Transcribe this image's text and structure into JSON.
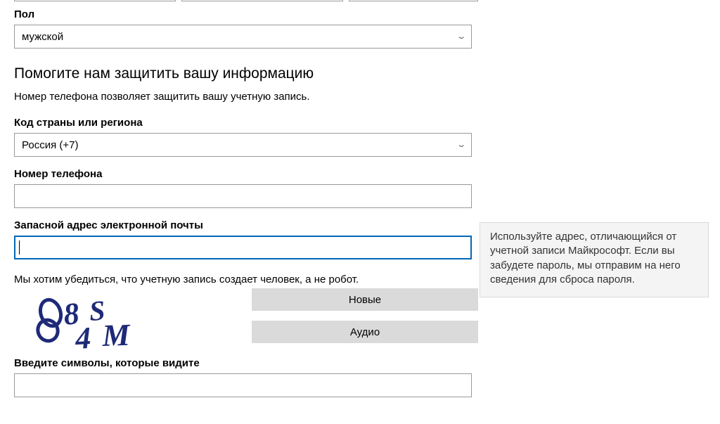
{
  "gender": {
    "label": "Пол",
    "value": "мужской"
  },
  "section_heading": "Помогите нам защитить вашу информацию",
  "section_subtext": "Номер телефона позволяет защитить вашу учетную запись.",
  "country_code": {
    "label": "Код страны или региона",
    "value": "Россия (+7)"
  },
  "phone": {
    "label": "Номер телефона",
    "value": ""
  },
  "backup_email": {
    "label": "Запасной адрес электронной почты",
    "value": ""
  },
  "tooltip_text": "Используйте адрес, отличающийся от учетной записи Майкрософт. Если вы забудете пароль, мы отправим на него сведения для сброса пароля.",
  "robot_text": "Мы хотим убедиться, что учетную запись создает человек, а не робот.",
  "captcha": {
    "new_label": "Новые",
    "audio_label": "Аудио",
    "input_label": "Введите символы, которые видите",
    "input_value": ""
  }
}
